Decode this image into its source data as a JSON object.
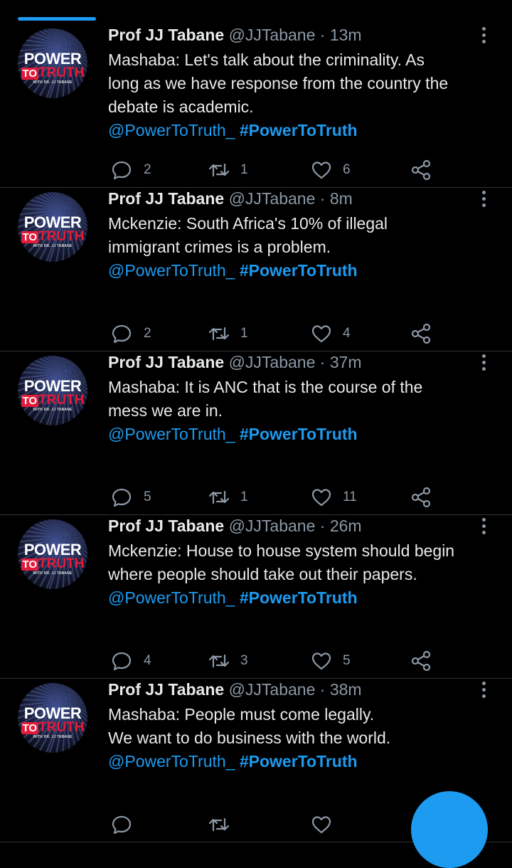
{
  "colors": {
    "background": "#000000",
    "accent": "#1d9bf0",
    "text": "#e7e9ea",
    "secondary": "#8b98a5"
  },
  "avatar_logo": {
    "line1": "POWER",
    "line2a": "TO",
    "line2b": "TRUTH",
    "line3": "WITH DR. JJ TABANE"
  },
  "tweets": [
    {
      "name": "Prof JJ Tabane",
      "handle": "@JJTabane",
      "sep": "·",
      "time": "13m",
      "lines": [
        "Mashaba: Let's talk about the criminality. As",
        "long as we have response from the country the",
        "debate is academic."
      ],
      "mention": "@PowerToTruth_",
      "hashtag": "#PowerToTruth",
      "replies": "2",
      "retweets": "1",
      "likes": "6"
    },
    {
      "name": "Prof JJ Tabane",
      "handle": "@JJTabane",
      "sep": "·",
      "time": "8m",
      "lines": [
        "Mckenzie: South Africa's 10% of illegal",
        "immigrant crimes is a problem."
      ],
      "mention": "@PowerToTruth_",
      "hashtag": "#PowerToTruth",
      "replies": "2",
      "retweets": "1",
      "likes": "4"
    },
    {
      "name": "Prof JJ Tabane",
      "handle": "@JJTabane",
      "sep": "·",
      "time": "37m",
      "lines": [
        "Mashaba: It is ANC that is the course of the",
        "mess we are in."
      ],
      "mention": "@PowerToTruth_",
      "hashtag": "#PowerToTruth",
      "replies": "5",
      "retweets": "1",
      "likes": "11"
    },
    {
      "name": "Prof JJ Tabane",
      "handle": "@JJTabane",
      "sep": "·",
      "time": "26m",
      "lines": [
        "Mckenzie: House to house system should begin",
        "where people should take out their papers."
      ],
      "mention": "@PowerToTruth_",
      "hashtag": "#PowerToTruth",
      "replies": "4",
      "retweets": "3",
      "likes": "5"
    },
    {
      "name": "Prof JJ Tabane",
      "handle": "@JJTabane",
      "sep": "·",
      "time": "38m",
      "lines": [
        "Mashaba: People must come legally.",
        "We want to do business with the world."
      ],
      "mention": "@PowerToTruth_",
      "hashtag": "#PowerToTruth",
      "replies": "",
      "retweets": "",
      "likes": ""
    }
  ],
  "icons": {
    "reply": "reply-icon",
    "retweet": "retweet-icon",
    "like": "heart-icon",
    "share": "share-icon",
    "more": "more-vertical-icon",
    "fab": "compose-fab"
  }
}
